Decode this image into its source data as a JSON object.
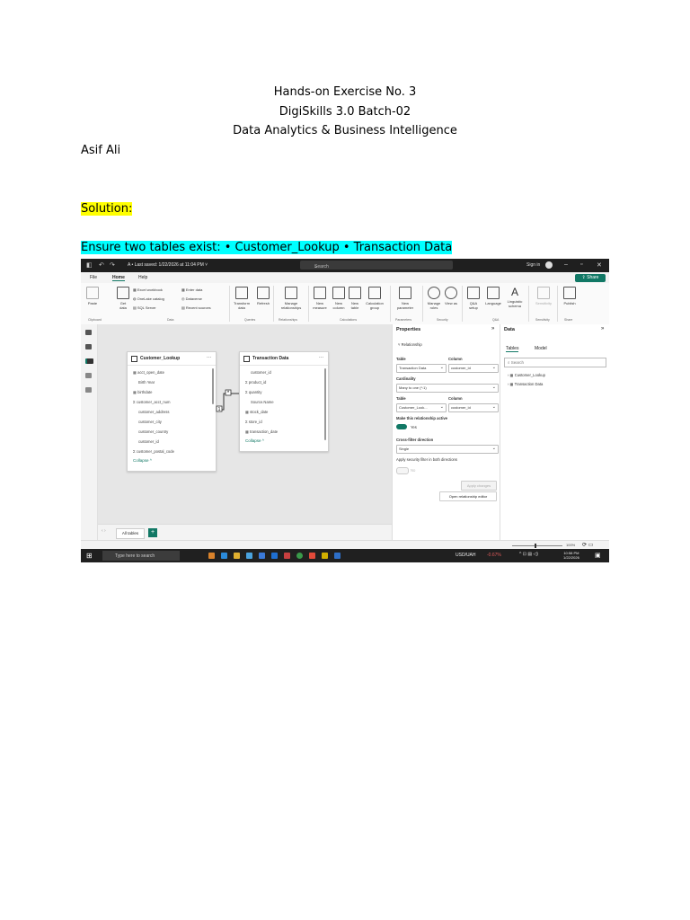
{
  "document": {
    "title_line1": "Hands-on Exercise No. 3",
    "title_line2": "DigiSkills 3.0 Batch-02",
    "title_line3": "Data Analytics & Business Intelligence",
    "author": "Asif Ali",
    "solution_label": "Solution:",
    "instruction": "Ensure two tables exist: • Customer_Lookup • Transaction Data"
  },
  "screenshot": {
    "titlebar": {
      "saved_text": "A • Last saved: 1/22/2026 at 11:04 PM ˅",
      "search_placeholder": "Search",
      "signin": "Sign in"
    },
    "menu": {
      "file": "File",
      "home": "Home",
      "help": "Help",
      "share": "Share"
    },
    "ribbon": {
      "paste": "Paste",
      "get_data": "Get data",
      "excel": "Excel workbook",
      "onelake": "OneLake catalog",
      "sql": "SQL Server",
      "enter_data": "Enter data",
      "dataverse": "Dataverse",
      "recent": "Recent sources",
      "transform": "Transform data",
      "refresh": "Refresh",
      "manage_rel": "Manage relationships",
      "new_measure": "New measure",
      "new_column": "New column",
      "new_table": "New table",
      "calc_group": "Calculation group",
      "new_param": "New parameter",
      "manage_roles": "Manage roles",
      "view_as": "View as",
      "qa_setup": "Q&A setup",
      "language": "Language",
      "ling_schema": "Linguistic schema",
      "sensitivity": "Sensitivity",
      "publish": "Publish",
      "groups": {
        "clipboard": "Clipboard",
        "data": "Data",
        "queries": "Queries",
        "relationships": "Relationships",
        "calculations": "Calculations",
        "parameters": "Parameters",
        "security": "Security",
        "qa": "Q&A",
        "sensitivity": "Sensitivity",
        "share": "Share"
      }
    },
    "customer_table": {
      "name": "Customer_Lookup",
      "fields": [
        "acct_open_date",
        "Birth Year",
        "birthdate",
        "customer_acct_num",
        "customer_address",
        "customer_city",
        "customer_country",
        "customer_id",
        "customer_postal_code"
      ],
      "collapse": "Collapse ^"
    },
    "transaction_table": {
      "name": "Transaction Data",
      "fields": [
        "customer_id",
        "product_id",
        "quantity",
        "Source.Name",
        "stock_date",
        "store_id",
        "transaction_date"
      ],
      "collapse": "Collapse ^"
    },
    "relationship_markers": {
      "one": "1",
      "many": "*"
    },
    "bottom": {
      "all_tables": "All tables",
      "add": "+"
    },
    "properties": {
      "title": "Properties",
      "section": "Relationship",
      "table_label": "Table",
      "column_label": "Column",
      "table1": "Transaction Data",
      "column1": "customer_id",
      "cardinality_label": "Cardinality",
      "cardinality": "Many to one (*:1)",
      "table2": "Customer_Look...",
      "column2": "customer_id",
      "active_label": "Make this relationship active",
      "active_value": "Yes",
      "crossfilter_label": "Cross-filter direction",
      "crossfilter": "Single",
      "security_label": "Apply security filter in both directions",
      "security_value": "No",
      "apply": "Apply changes",
      "open_editor": "Open relationship editor"
    },
    "data_pane": {
      "title": "Data",
      "tab_tables": "Tables",
      "tab_model": "Model",
      "search": "Search",
      "items": [
        "Customer_Lookup",
        "Transaction Data"
      ]
    },
    "status": {
      "zoom": "100%"
    },
    "taskbar": {
      "search": "Type here to search",
      "ticker": "USD/UAH",
      "ticker_change": "-0.67%",
      "time": "10:58 PM",
      "date": "1/22/2026"
    },
    "colors": {
      "accent": "#117865",
      "highlight_yellow": "#ffff00",
      "highlight_cyan": "#00ffff"
    }
  }
}
